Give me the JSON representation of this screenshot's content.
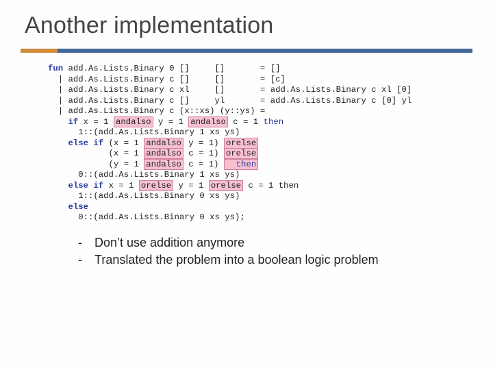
{
  "title": "Another implementation",
  "code": {
    "l1_fun": "fun",
    "l1_a": " add.As.Lists.Binary 0 []     []       = []",
    "l2": "  | add.As.Lists.Binary c []     []       = [c]",
    "l3": "  | add.As.Lists.Binary c xl     []       = add.As.Lists.Binary c xl [0]",
    "l4": "  | add.As.Lists.Binary c []     yl       = add.As.Lists.Binary c [0] yl",
    "l5": "  | add.As.Lists.Binary c (x::xs) (y::ys) =",
    "l6_if": "    if",
    "l6_a": " x = 1 ",
    "l6_and": "andalso",
    "l6_b": " y = 1 ",
    "l6_c": " c = 1 ",
    "l6_then": "then",
    "l7": "      1::(add.As.Lists.Binary 1 xs ys)",
    "l8_elif": "    else if",
    "l8_a": " (x = 1 ",
    "l8_b": " y = 1) ",
    "orelse": "orelse",
    "l9_a": "            (x = 1 ",
    "l9_b": " c = 1) ",
    "l10_a": "            (y = 1 ",
    "l10_b": " c = 1) ",
    "l10_then": "  then",
    "l11": "      0::(add.As.Lists.Binary 1 xs ys)",
    "l12_elif": "    else if",
    "l12_a": " x = 1 ",
    "l12_b": " y = 1 ",
    "l12_c": " c = 1 then",
    "l13": "      1::(add.As.Lists.Binary 0 xs ys)",
    "l14_else": "    else",
    "l15": "      0::(add.As.Lists.Binary 0 xs ys);"
  },
  "bullets": {
    "dash": "-",
    "b1": "Don’t use addition anymore",
    "b2": "Translated the problem into a boolean logic problem"
  }
}
